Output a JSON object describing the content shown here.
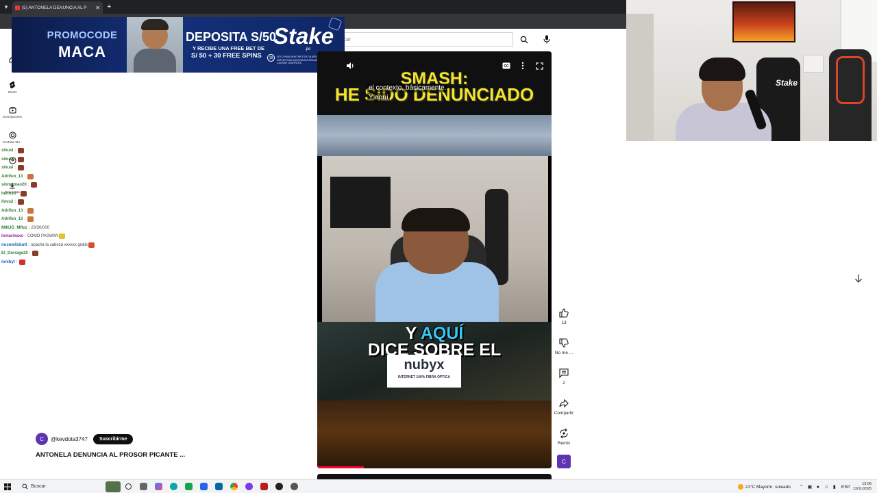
{
  "browser": {
    "tab_title": "(5) ANTONELA DENUNCIA AL P",
    "new_tab": "+"
  },
  "youtube": {
    "search_placeholder": "car",
    "nav": [
      {
        "label": "",
        "icon": "home-icon"
      },
      {
        "label": "Shorts",
        "icon": "shorts-icon"
      },
      {
        "label": "Suscripciones",
        "icon": "subscriptions-icon"
      },
      {
        "label": "YouTube Mu...",
        "icon": "youtube-music-icon"
      },
      {
        "label": "",
        "icon": "you-icon"
      },
      {
        "label": "Descargas",
        "icon": "downloads-icon"
      }
    ]
  },
  "ad": {
    "promo_line1": "PROMOCODE",
    "promo_line2": "MACA",
    "deposita": "DEPOSITA S/50",
    "recibe": "Y RECIBE UNA FREE BET DE",
    "spins": "S/ 50 + 30 FREE SPINS",
    "brand": "Stake",
    "brand_suffix": ".pe",
    "age": "18",
    "legal": "SÓLO PARA MAYORES DE 18 AÑOS. LAS APUESTAS DEPORTIVAS A DISTANCIA REALIZADAS EN EXCESO PUEDEN CAUSAR LUDOPATÍA."
  },
  "chat": {
    "messages": [
      {
        "user": "slnusl",
        "msg": "",
        "color": "#2e7d32",
        "emote": "#8a3b2a"
      },
      {
        "user": "slnusl",
        "msg": "",
        "color": "#2e7d32",
        "emote": "#8a3b2a"
      },
      {
        "user": "slnusl",
        "msg": "",
        "color": "#2e7d32",
        "emote": "#8a3b2a"
      },
      {
        "user": "Adrifun_13",
        "msg": "",
        "color": "#2e7d32",
        "emote": "#c8743a"
      },
      {
        "user": "sinmumao20",
        "msg": "",
        "color": "#2e7d32",
        "emote": "#8a3b2a"
      },
      {
        "user": "hennsil",
        "msg": "",
        "color": "#2e7d32",
        "emote": "#8a3b2a"
      },
      {
        "user": "Ilovo2",
        "msg": "",
        "color": "#2e7d32",
        "emote": "#8a3b2a"
      },
      {
        "user": "Adrifun_13",
        "msg": "",
        "color": "#2e7d32",
        "emote": "#c8743a"
      },
      {
        "user": "Adrifun_13",
        "msg": "",
        "color": "#2e7d32",
        "emote": "#c8743a"
      },
      {
        "user": "MINJO_MRzz",
        "msg": "23/30/000",
        "color": "#2e7d32",
        "emote": ""
      },
      {
        "user": "lomarinaxo",
        "msg": "COMO PASWAN",
        "color": "#8e24aa",
        "emote": "#e3c02e"
      },
      {
        "user": "nosmellsbutt",
        "msg": "opacha la cabeza xxxxxx gratis",
        "color": "#1565c0",
        "emote": "#d94d2f"
      },
      {
        "user": "El_Dorrage20",
        "msg": "",
        "color": "#2e7d32",
        "emote": "#8a3b2a"
      },
      {
        "user": "lonibyt",
        "msg": "",
        "color": "#1565c0",
        "emote": "#d32f2f"
      }
    ]
  },
  "channel": {
    "avatar_letter": "C",
    "handle": "@kevdota3747",
    "subscribe": "Suscribirme"
  },
  "video": {
    "title": "ANTONELA DENUNCIA AL PROSOR PICANTE  ..."
  },
  "player": {
    "title_line1": "SMASH:",
    "title_line2": "HE SIDO DENUNCIADO",
    "caption_line1": "el contexto, básicamente.",
    "caption_line2": "Y aquí",
    "overlay_pre": "Y ",
    "overlay_word": "AQUÍ",
    "overlay_line2": "DICE SOBRE EL",
    "sponsor": "nubyx",
    "sponsor_tag": "INTERNET 100% FIBRA ÓPTICA",
    "progress": 0.2
  },
  "actions": {
    "like_count": "13",
    "dislike_label": "No me ...",
    "comments_count": "2",
    "share_label": "Compartir",
    "remix_label": "Remix",
    "avatar_letter": "C"
  },
  "webcam": {
    "logo_text": "Stake"
  },
  "taskbar": {
    "search_label": "Buscar",
    "weather": "21°C  Mayorm. soleado",
    "lang": "ESP",
    "time": "13:06",
    "date": "13/11/2025"
  },
  "colors": {
    "youtube_red": "#ff0033",
    "ad_blue": "#14307a",
    "title_yellow": "#f4e42a"
  }
}
